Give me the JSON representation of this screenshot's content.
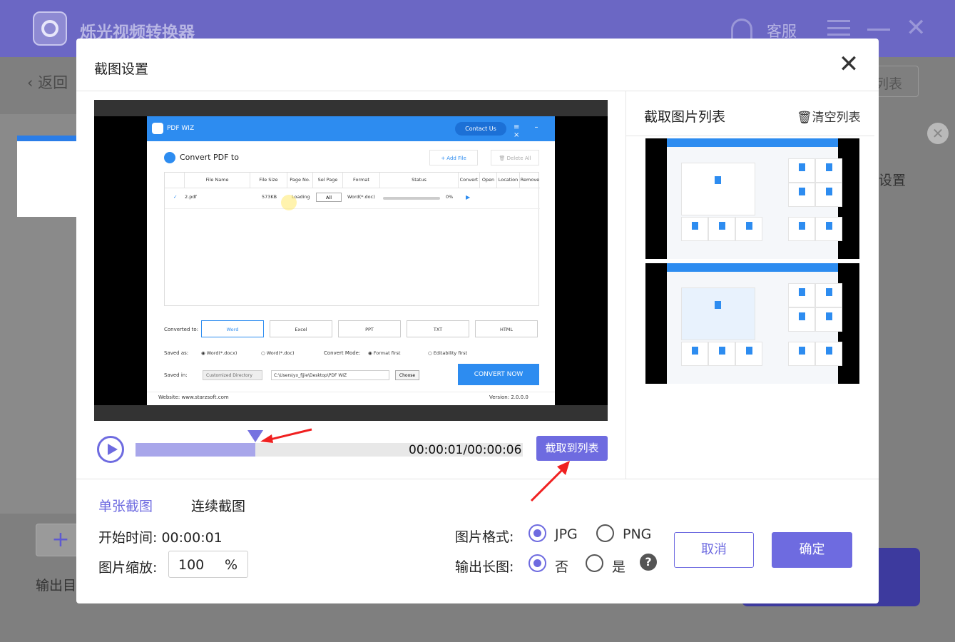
{
  "app": {
    "title": "烁光视频转换器",
    "service": "客服"
  },
  "background": {
    "back": "返回",
    "list_btn": "列表",
    "setting": "设置",
    "output": "输出目",
    "add": "+"
  },
  "dialog": {
    "title": "截图设置",
    "close": "✕",
    "list_title": "截取图片列表",
    "clear_list": "清空列表",
    "time": "00:00:01/00:00:06",
    "progress_fraction": 0.31,
    "capture_btn": "截取到列表",
    "mode_single": "单张截图",
    "mode_continuous": "连续截图",
    "start_time": "开始时间: 00:00:01",
    "scale_label": "图片缩放:",
    "scale_value": "100",
    "scale_unit": "%",
    "format_label": "图片格式:",
    "format_options": [
      "JPG",
      "PNG"
    ],
    "format_selected": "JPG",
    "long_label": "输出长图:",
    "long_options": [
      "否",
      "是"
    ],
    "long_selected": "否",
    "help": "?",
    "cancel": "取消",
    "ok": "确定"
  },
  "preview": {
    "app_name": "PDF WIZ",
    "contact": "Contact Us",
    "window_controls": "≡ – ×",
    "heading": "Convert PDF to",
    "add_file": "Add File",
    "delete_all": "Delete All",
    "columns": [
      "File Name",
      "File Size",
      "Page No.",
      "Sel Page",
      "Format",
      "Status",
      "Convert",
      "Open",
      "Location",
      "Remove"
    ],
    "row": {
      "name": "2.pdf",
      "size": "573KB",
      "page": "Loading",
      "sel": "All",
      "format": "Word(*.doc)",
      "pct": "0%"
    },
    "converted_to": "Converted to:",
    "formats": [
      "Word",
      "Excel",
      "PPT",
      "TXT",
      "HTML"
    ],
    "saved_as": "Saved as:",
    "save_opts": [
      "Word(*.docx)",
      "Word(*.doc)"
    ],
    "mode": "Convert Mode:",
    "mode_opts": [
      "Format first",
      "Editability first"
    ],
    "saved_in": "Saved in:",
    "dir_type": "Customized Directory",
    "path": "C:\\Users\\yx_fjjie\\Desktop\\PDF WIZ",
    "choose": "Choose",
    "convert_now": "CONVERT NOW",
    "website": "Website: www.starzsoft.com",
    "version": "Version: 2.0.0.0"
  },
  "colors": {
    "accent": "#6e6be0",
    "pdfwiz_blue": "#2d8cf0",
    "header": "#6b67c4"
  },
  "icons": [
    "play-icon",
    "trash-icon",
    "close-icon",
    "help-icon",
    "headset-icon",
    "menu-icon",
    "minimize-icon"
  ]
}
